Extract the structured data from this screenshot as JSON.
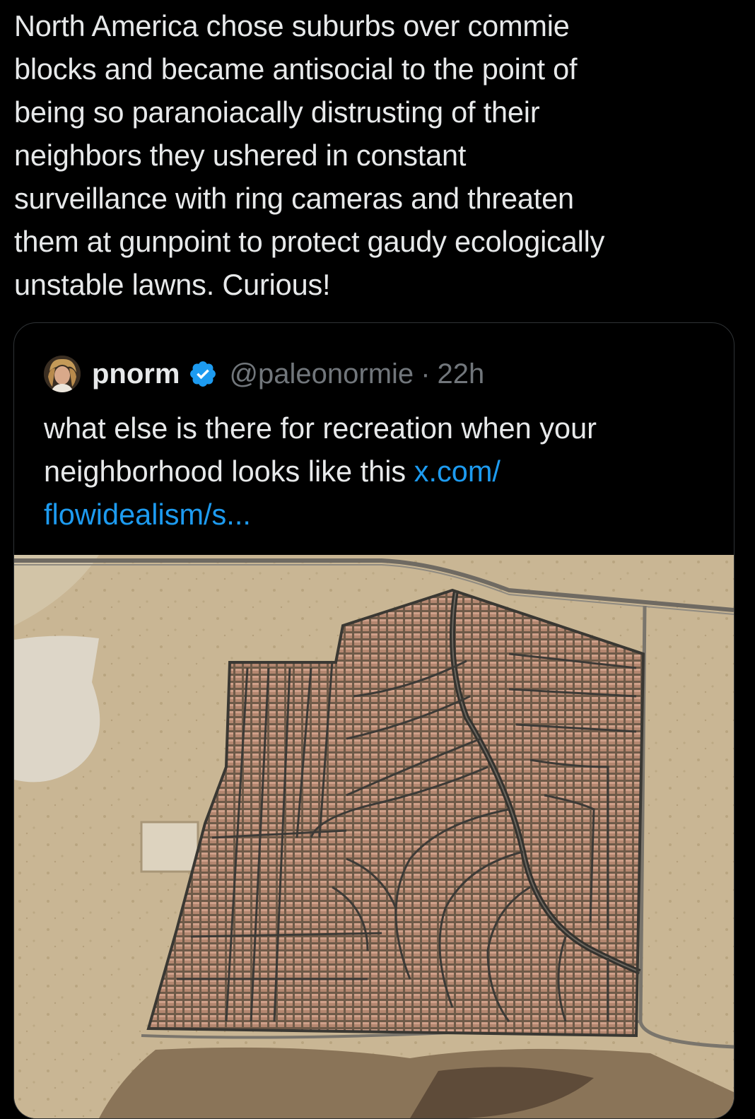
{
  "tweet": {
    "text": "North America chose suburbs over commie\nblocks and became antisocial to the point of\nbeing so paranoiacally distrusting of their\nneighbors they ushered in constant\nsurveillance with ring cameras and threaten\nthem at gunpoint to protect gaudy ecologically\nunstable lawns. Curious!"
  },
  "quote": {
    "display_name": "pnorm",
    "handle": "@paleonormie",
    "separator": "·",
    "time": "22h",
    "text_line1": "what else is there for recreation when your",
    "text_line2": "neighborhood looks like this ",
    "link_part1": "x.com/",
    "link_part2": "flowidealism/s...",
    "verified": true,
    "avatar_icon": "profile-photo",
    "media_icon": "aerial-suburb-photo",
    "colors": {
      "background": "#000000",
      "text": "#e7e9ea",
      "muted": "#71767b",
      "link": "#1d9bf0",
      "border": "#2f3336",
      "verified": "#1d9bf0"
    }
  }
}
